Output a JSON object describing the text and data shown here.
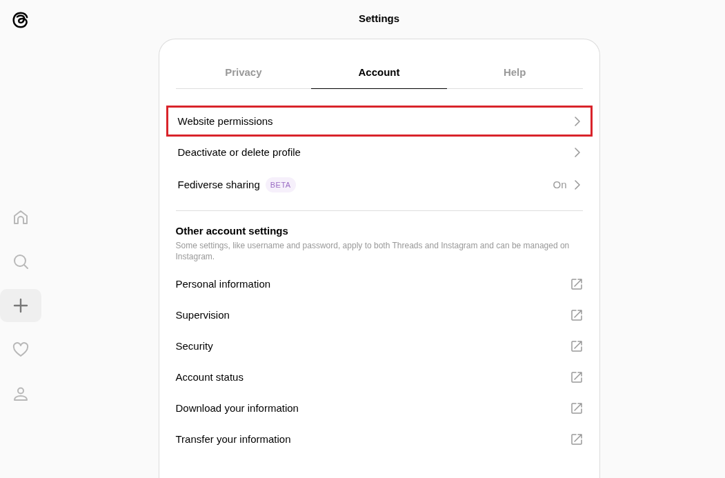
{
  "sidebar": {
    "items": [
      {
        "kind": "home",
        "selected": false
      },
      {
        "kind": "search",
        "selected": false
      },
      {
        "kind": "create",
        "selected": true
      },
      {
        "kind": "activity",
        "selected": false
      },
      {
        "kind": "profile",
        "selected": false
      }
    ]
  },
  "page_title": "Settings",
  "tabs": [
    {
      "label": "Privacy",
      "selected": false
    },
    {
      "label": "Account",
      "selected": true
    },
    {
      "label": "Help",
      "selected": false
    }
  ],
  "settings": [
    {
      "label": "Website permissions",
      "highlighted": true
    },
    {
      "label": "Deactivate or delete profile",
      "highlighted": false
    },
    {
      "label": "Fediverse sharing",
      "badge": "BETA",
      "value": "On",
      "highlighted": false
    }
  ],
  "other_section": {
    "title": "Other account settings",
    "description": "Some settings, like username and password, apply to both Threads and Instagram and can be managed on Instagram.",
    "links": [
      {
        "label": "Personal information"
      },
      {
        "label": "Supervision"
      },
      {
        "label": "Security"
      },
      {
        "label": "Account status"
      },
      {
        "label": "Download your information"
      },
      {
        "label": "Transfer your information"
      }
    ]
  }
}
